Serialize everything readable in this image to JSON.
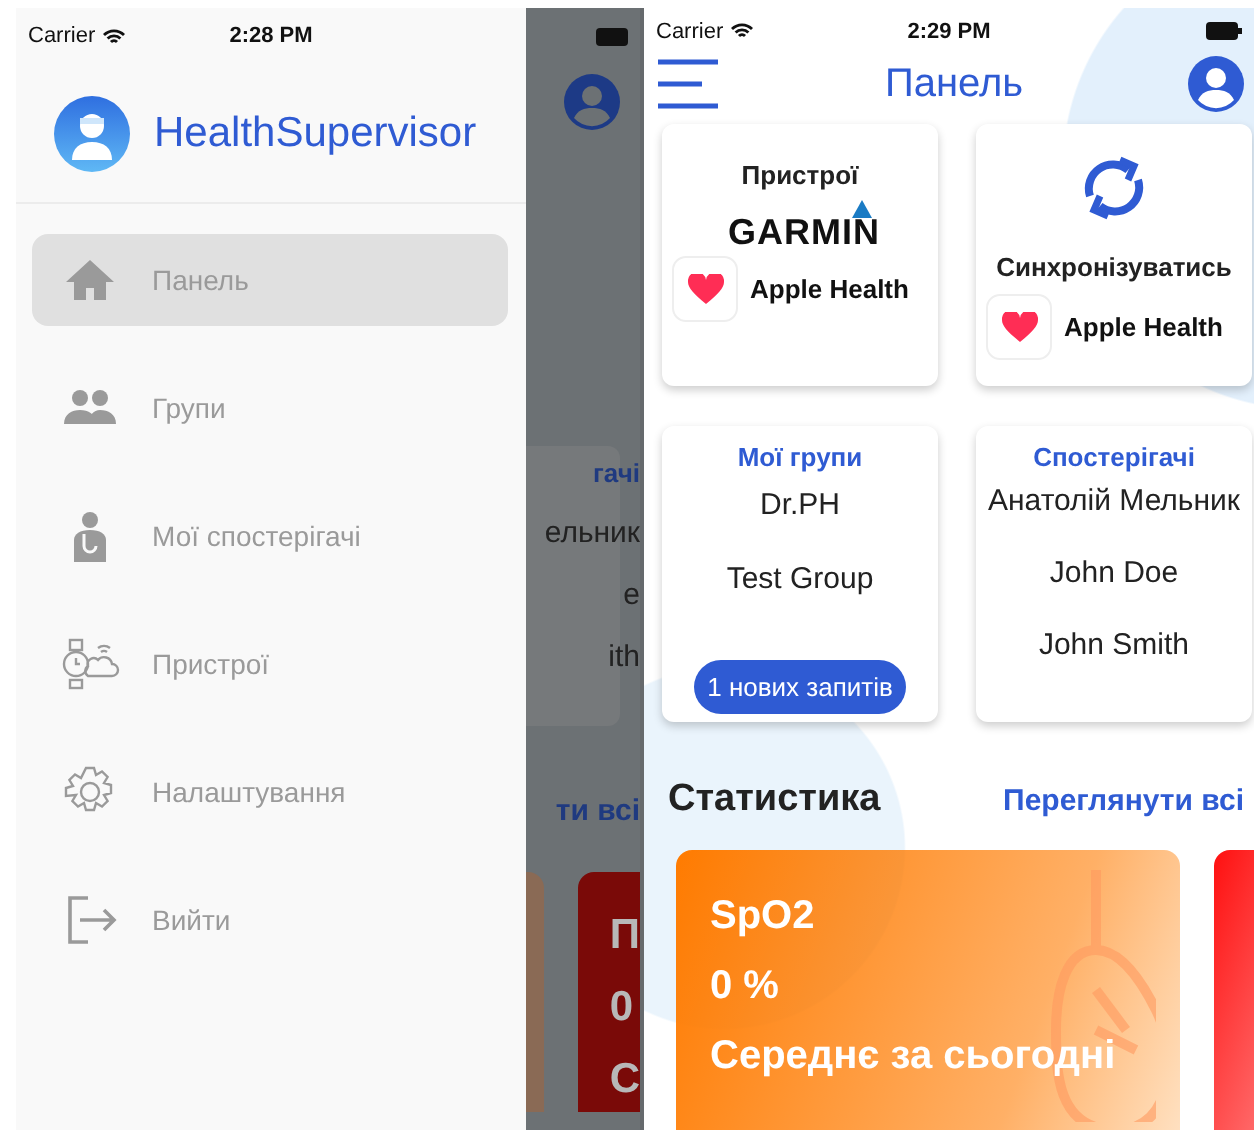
{
  "drawer_screen": {
    "status_bar": {
      "carrier": "Carrier",
      "time": "2:28 PM"
    },
    "app_name": "HealthSupervisor",
    "menu": [
      {
        "label": "Панель",
        "kind": "home",
        "selected": true
      },
      {
        "label": "Групи",
        "kind": "groups",
        "selected": false
      },
      {
        "label": "Мої спостерігачі",
        "kind": "observers",
        "selected": false
      },
      {
        "label": "Пристрої",
        "kind": "devices",
        "selected": false
      },
      {
        "label": "Налаштування",
        "kind": "settings",
        "selected": false
      },
      {
        "label": "Вийти",
        "kind": "logout",
        "selected": false
      }
    ],
    "background_fragments": {
      "card_title": "гачі",
      "card_items": [
        "ельник",
        "e",
        "ith"
      ],
      "link": "ти всі",
      "stat_card_texts": [
        "П",
        "0",
        "С"
      ]
    }
  },
  "dashboard_screen": {
    "status_bar": {
      "carrier": "Carrier",
      "time": "2:29 PM"
    },
    "title": "Панель",
    "devices_card": {
      "title": "Пристрої",
      "brand": "GARMIN",
      "app": "Apple Health"
    },
    "sync_card": {
      "title": "Синхронізуватись",
      "app": "Apple Health"
    },
    "groups_card": {
      "title": "Мої групи",
      "items": [
        "Dr.PH",
        "Test Group"
      ],
      "badge": "1 нових запитів"
    },
    "observers_card": {
      "title": "Спостерігачі",
      "items": [
        "Анатолій Мельник",
        "John Doe",
        "John Smith"
      ]
    },
    "statistics": {
      "title": "Статистика",
      "link": "Переглянути всі",
      "cards": [
        {
          "kind": "spo2",
          "title": "SpO2",
          "value": "0 %",
          "caption": "Середнє за сьогодні",
          "color": "#ff7b00"
        },
        {
          "kind": "heart",
          "color": "#ff1010"
        }
      ]
    }
  }
}
